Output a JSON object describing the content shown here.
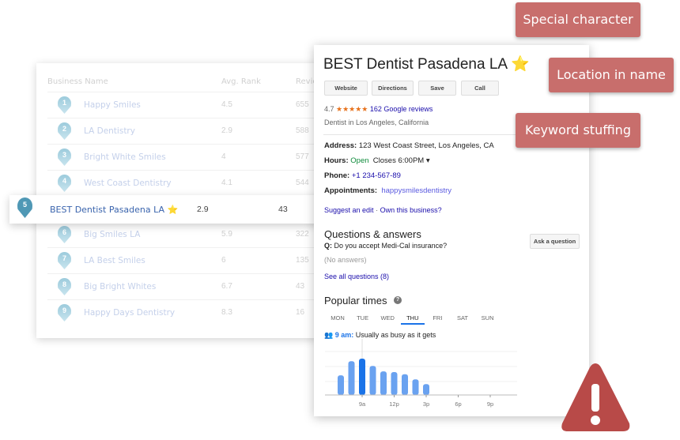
{
  "table": {
    "headers": [
      "Business Name",
      "Avg. Rank",
      "Reviews"
    ],
    "rows": [
      {
        "num": "1",
        "name": "Happy Smiles",
        "rank": "4.5",
        "reviews": "655"
      },
      {
        "num": "2",
        "name": "LA Dentistry",
        "rank": "2.9",
        "reviews": "588"
      },
      {
        "num": "3",
        "name": "Bright White Smiles",
        "rank": "4",
        "reviews": "577"
      },
      {
        "num": "4",
        "name": "West Coast Dentistry",
        "rank": "4.1",
        "reviews": "544"
      },
      {
        "num": "5",
        "name": "BEST Dentist Pasadena LA ⭐",
        "rank": "2.9",
        "reviews": "43"
      },
      {
        "num": "6",
        "name": "Big Smiles LA",
        "rank": "5.9",
        "reviews": "322"
      },
      {
        "num": "7",
        "name": "LA Best Smiles",
        "rank": "6",
        "reviews": "135"
      },
      {
        "num": "8",
        "name": "Big Bright Whites",
        "rank": "6.7",
        "reviews": "43"
      },
      {
        "num": "9",
        "name": "Happy Days Dentistry",
        "rank": "8.3",
        "reviews": "16"
      }
    ]
  },
  "panel": {
    "title": "BEST Dentist Pasadena LA ⭐",
    "buttons": [
      "Website",
      "Directions",
      "Save",
      "Call"
    ],
    "rating": "4.7",
    "stars": "★★★★★",
    "reviews_link": "162 Google reviews",
    "category": "Dentist in Los Angeles, California",
    "address_label": "Address:",
    "address": "123 West Coast Street, Los Angeles, CA",
    "hours_label": "Hours:",
    "hours_status": "Open",
    "hours_close": "Closes 6:00PM ▾",
    "phone_label": "Phone:",
    "phone": "+1 234-567-89",
    "appt_label": "Appointments:",
    "appt": "happysmilesdentistry",
    "suggest": "Suggest an edit",
    "own": "Own this business?",
    "sep": " · ",
    "qa_title": "Questions & answers",
    "ask": "Ask a question",
    "q_label": "Q:",
    "question": "Do you accept Medi-Cal insurance?",
    "no_answers": "(No answers)",
    "see_all": "See all questions (8)",
    "popular_title": "Popular times",
    "help_icon": "?",
    "days": [
      "MON",
      "TUE",
      "WED",
      "THU",
      "FRI",
      "SAT",
      "SUN"
    ],
    "selected_day": "THU",
    "busy_time": "9 am:",
    "busy_text": "Usually as busy as it gets"
  },
  "chart_data": {
    "type": "bar",
    "categories": [
      "7a",
      "8a",
      "9a",
      "10a",
      "11a",
      "12p",
      "1p",
      "2p",
      "3p"
    ],
    "values": [
      54,
      93,
      100,
      80,
      65,
      63,
      57,
      43,
      30
    ],
    "highlight": "9a",
    "tick_labels": [
      "9a",
      "12p",
      "3p",
      "6p",
      "9p"
    ],
    "colors": {
      "bar": "#6aa2f0",
      "highlight": "#1a73e8"
    }
  },
  "annotations": [
    "Special character",
    "Location in name",
    "Keyword stuffing"
  ],
  "colors": {
    "annotation": "#c86e6c",
    "warning": "#b84a48",
    "link": "#1a0dab",
    "open": "#0d8a3a",
    "stars": "#e7711b"
  }
}
